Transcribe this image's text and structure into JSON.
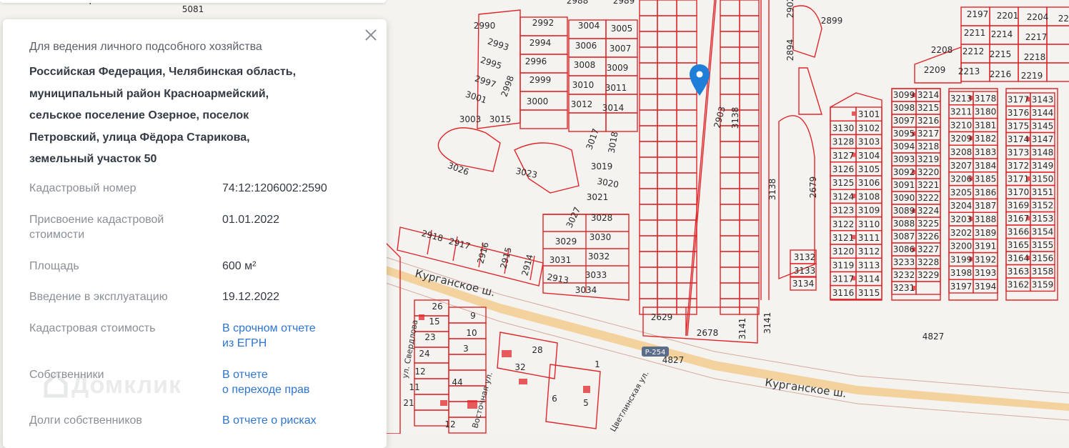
{
  "map": {
    "plots_top_left": [
      "2988",
      "2989",
      "5081",
      "4",
      "2990",
      "2992",
      "3004",
      "3005",
      "2993",
      "2994",
      "3006",
      "3007",
      "2995",
      "2996",
      "3008",
      "3009",
      "2997",
      "2998",
      "2999",
      "3010",
      "3011",
      "3001",
      "3000",
      "3012",
      "3014",
      "3003",
      "3015",
      "3017",
      "3018",
      "3026",
      "3023",
      "3019",
      "3020",
      "3021",
      "2918",
      "2917",
      "2916",
      "2915",
      "2914",
      "3027",
      "3028",
      "3029",
      "3030",
      "3031",
      "3032",
      "2913",
      "3033",
      "3034"
    ],
    "plots_center": [
      "2899",
      "2894",
      "2902",
      "2903",
      "3138",
      "3138",
      "2679",
      "2629",
      "2678",
      "3141",
      "3141",
      "4827"
    ],
    "plots_right_top": [
      "2197",
      "2201",
      "2204",
      "2205",
      "2211",
      "2214",
      "2217",
      "2208",
      "2212",
      "2215",
      "2218",
      "2209",
      "2213",
      "2216",
      "2219"
    ],
    "plots_grid_a": [
      [
        "3099",
        "3214"
      ],
      [
        "3098",
        "3215"
      ],
      [
        "3097",
        "3216"
      ],
      [
        "3095",
        "3217"
      ],
      [
        "3094",
        "3218"
      ],
      [
        "3093",
        "3219"
      ],
      [
        "3092",
        "3220"
      ],
      [
        "3091",
        "3221"
      ],
      [
        "3090",
        "3222"
      ],
      [
        "3089",
        "3224"
      ],
      [
        "3088",
        "3225"
      ],
      [
        "3087",
        "3226"
      ],
      [
        "3086",
        "3227"
      ],
      [
        "3233",
        "3228"
      ],
      [
        "3232",
        "3229"
      ],
      [
        "3231",
        ""
      ]
    ],
    "plots_grid_b": [
      [
        "3101"
      ],
      [
        "3130",
        "3102"
      ],
      [
        "3128",
        "3103"
      ],
      [
        "3127",
        "3104"
      ],
      [
        "3126",
        "3105"
      ],
      [
        "3125",
        "3106"
      ],
      [
        "3124",
        "3108"
      ],
      [
        "3123",
        "3109"
      ],
      [
        "3122",
        "3110"
      ],
      [
        "3121",
        "3111"
      ],
      [
        "3120",
        "3112"
      ],
      [
        "3119",
        "3113"
      ],
      [
        "3117",
        "3114"
      ],
      [
        "3116",
        "3115"
      ]
    ],
    "plots_grid_c": [
      [
        "3213",
        "3178"
      ],
      [
        "3211",
        "3180"
      ],
      [
        "3210",
        "3181"
      ],
      [
        "3209",
        "3182"
      ],
      [
        "3208",
        "3183"
      ],
      [
        "3207",
        "3184"
      ],
      [
        "3206",
        "3185"
      ],
      [
        "3205",
        "3186"
      ],
      [
        "3204",
        "3187"
      ],
      [
        "3203",
        "3188"
      ],
      [
        "3202",
        "3189"
      ],
      [
        "3200",
        "3191"
      ],
      [
        "3199",
        "3192"
      ],
      [
        "3198",
        "3193"
      ],
      [
        "3197",
        "3194"
      ]
    ],
    "plots_grid_d": [
      [
        "3177",
        "3143"
      ],
      [
        "3176",
        "3144"
      ],
      [
        "3175",
        "3145"
      ],
      [
        "3174",
        "3147"
      ],
      [
        "3173",
        "3148"
      ],
      [
        "3172",
        "3149"
      ],
      [
        "3171",
        "3150"
      ],
      [
        "3170",
        "3151"
      ],
      [
        "3169",
        "3152"
      ],
      [
        "3167",
        "3153"
      ],
      [
        "3166",
        "3154"
      ],
      [
        "3165",
        "3155"
      ],
      [
        "3164",
        "3156"
      ],
      [
        "3163",
        "3158"
      ],
      [
        "3162",
        "3159"
      ]
    ],
    "plots_small_col": [
      "3132",
      "3133",
      "3134"
    ],
    "plots_bottom_left": [
      "26",
      "9",
      "15",
      "10",
      "23",
      "3",
      "24",
      "12",
      "44",
      "11",
      "21",
      "12",
      "28",
      "32",
      "1",
      "6",
      "5"
    ],
    "road_name": "Курганское ш.",
    "road_badge": "Р-254",
    "street_sverdlova": "ул. Свердлова",
    "street_vostochnaya": "Восточная ул.",
    "street_tsvetlinskaya": "Цветлинская ул.",
    "plot_line_color": "#e0262b",
    "road_color": "#f3c98a"
  },
  "card": {
    "category": "Для ведения личного подсобного хозяйства",
    "address_lines": [
      "Российская Федерация, Челябинская область,",
      "муниципальный район Красноармейский,",
      "сельское поселение Озерное, поселок",
      "Петровский, улица Фёдора Старикова,",
      "земельный участок 50"
    ],
    "rows": [
      {
        "label": [
          "Кадастровый номер"
        ],
        "value": [
          "74:12:1206002:2590"
        ],
        "link": false
      },
      {
        "label": [
          "Присвоение кадастровой",
          "стоимости"
        ],
        "value": [
          "01.01.2022"
        ],
        "link": false
      },
      {
        "label": [
          "Площадь"
        ],
        "value": [
          "600 м²"
        ],
        "link": false
      },
      {
        "label": [
          "Введение в эксплуатацию"
        ],
        "value": [
          "19.12.2022"
        ],
        "link": false
      },
      {
        "label": [
          "Кадастровая стоимость"
        ],
        "value": [
          "В срочном отчете",
          "из ЕГРН"
        ],
        "link": true
      },
      {
        "label": [
          "Собственники"
        ],
        "value": [
          "В отчете",
          "о переходе прав"
        ],
        "link": true
      },
      {
        "label": [
          "Долги собственников"
        ],
        "value": [
          "В отчете о рисках"
        ],
        "link": true
      }
    ],
    "watermark": "Домклик"
  }
}
